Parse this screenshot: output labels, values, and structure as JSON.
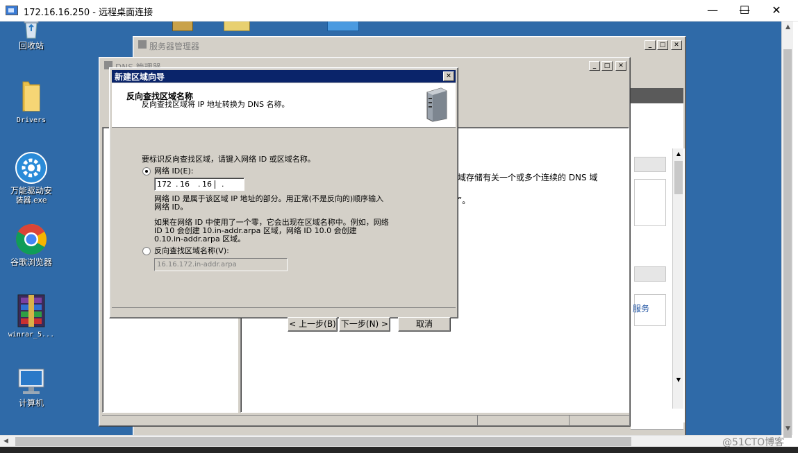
{
  "rdp": {
    "title": "172.16.16.250 - 远程桌面连接",
    "minimize": "—",
    "maximize": "☐",
    "close": "✕"
  },
  "desktop": {
    "icons": [
      {
        "label": "回收站",
        "icon": "recycle-bin-icon"
      },
      {
        "label": "Drivers",
        "icon": "folder-icon"
      },
      {
        "label": "万能驱动安",
        "label2": "装器.exe",
        "icon": "driver-installer-icon"
      },
      {
        "label": "谷歌浏览器",
        "icon": "chrome-icon"
      },
      {
        "label": "winrar_5...",
        "icon": "winrar-icon"
      },
      {
        "label": "计算机",
        "icon": "computer-icon"
      }
    ],
    "watermark": "@51CTO博客"
  },
  "server_manager": {
    "title": "服务器管理器",
    "min": "_",
    "max": "□",
    "close": "✕"
  },
  "dns_manager": {
    "title": "DNS 管理器",
    "min": "_",
    "max": "□",
    "close": "✕",
    "right_text_1": "域存储有关一个或多个连续的 DNS 域",
    "right_text_2": "”。",
    "right_text_3": "服务"
  },
  "wizard": {
    "title": "新建区域向导",
    "close": "✕",
    "header_title": "反向查找区域名称",
    "header_subtitle": "反向查找区域将 IP 地址转换为 DNS 名称。",
    "instruction": "要标识反向查找区域，请键入网络 ID 或区域名称。",
    "radio_network_id": "网络 ID(E):",
    "ip": {
      "o1": "172",
      "o2": "16",
      "o3": "16",
      "o4": ""
    },
    "help_1a": "网络 ID 是属于该区域 IP 地址的部分。用正常(不是反向的)顺序输入",
    "help_1b": "网络 ID。",
    "help_2a": "如果在网络 ID 中使用了一个零，它会出现在区域名称中。例如，网络",
    "help_2b": "ID 10 会创建 10.in-addr.arpa 区域，网络 ID 10.0 会创建",
    "help_2c": "0.10.in-addr.arpa 区域。",
    "radio_zone_name": "反向查找区域名称(V):",
    "zone_name_value": "16.16.172.in-addr.arpa",
    "btn_back": "< 上一步(B)",
    "btn_next": "下一步(N) >",
    "btn_cancel": "取消"
  }
}
